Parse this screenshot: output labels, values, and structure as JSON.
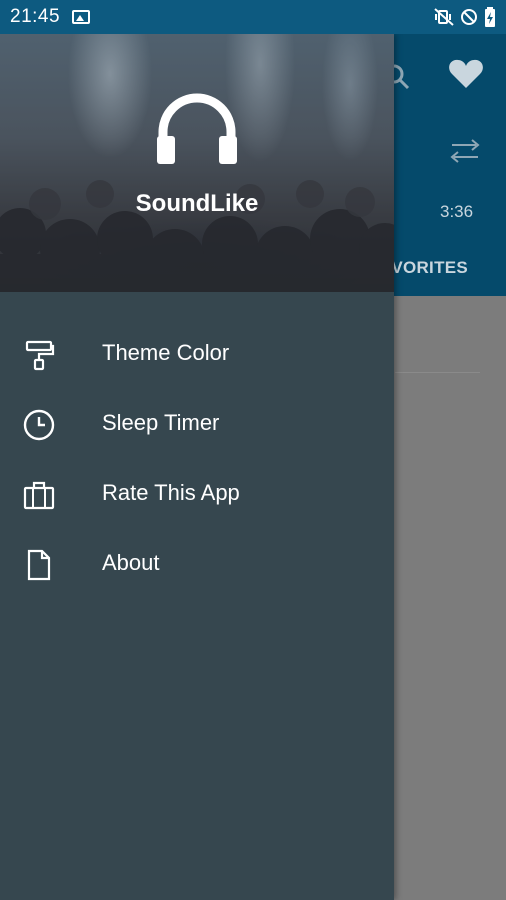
{
  "status_bar": {
    "time": "21:45",
    "icons": [
      "image-icon",
      "mute-vibrate-icon",
      "do-not-disturb-icon",
      "battery-charging-icon"
    ]
  },
  "background_app": {
    "track_duration": "3:36",
    "tab_partial": "AVORITES",
    "icons": [
      "search-icon",
      "heart-icon",
      "shuffle-icon"
    ]
  },
  "drawer": {
    "app_name": "SoundLike",
    "logo_icon": "headphones-icon",
    "items": [
      {
        "label": "Theme Color",
        "icon": "paint-roller-icon"
      },
      {
        "label": "Sleep Timer",
        "icon": "clock-icon"
      },
      {
        "label": "Rate This App",
        "icon": "briefcase-icon"
      },
      {
        "label": "About",
        "icon": "document-icon"
      }
    ]
  },
  "colors": {
    "status_bar": "#0d5a80",
    "app_header": "#054a6b",
    "drawer_bg": "#36474f",
    "scrim": "#7c7c7c"
  }
}
